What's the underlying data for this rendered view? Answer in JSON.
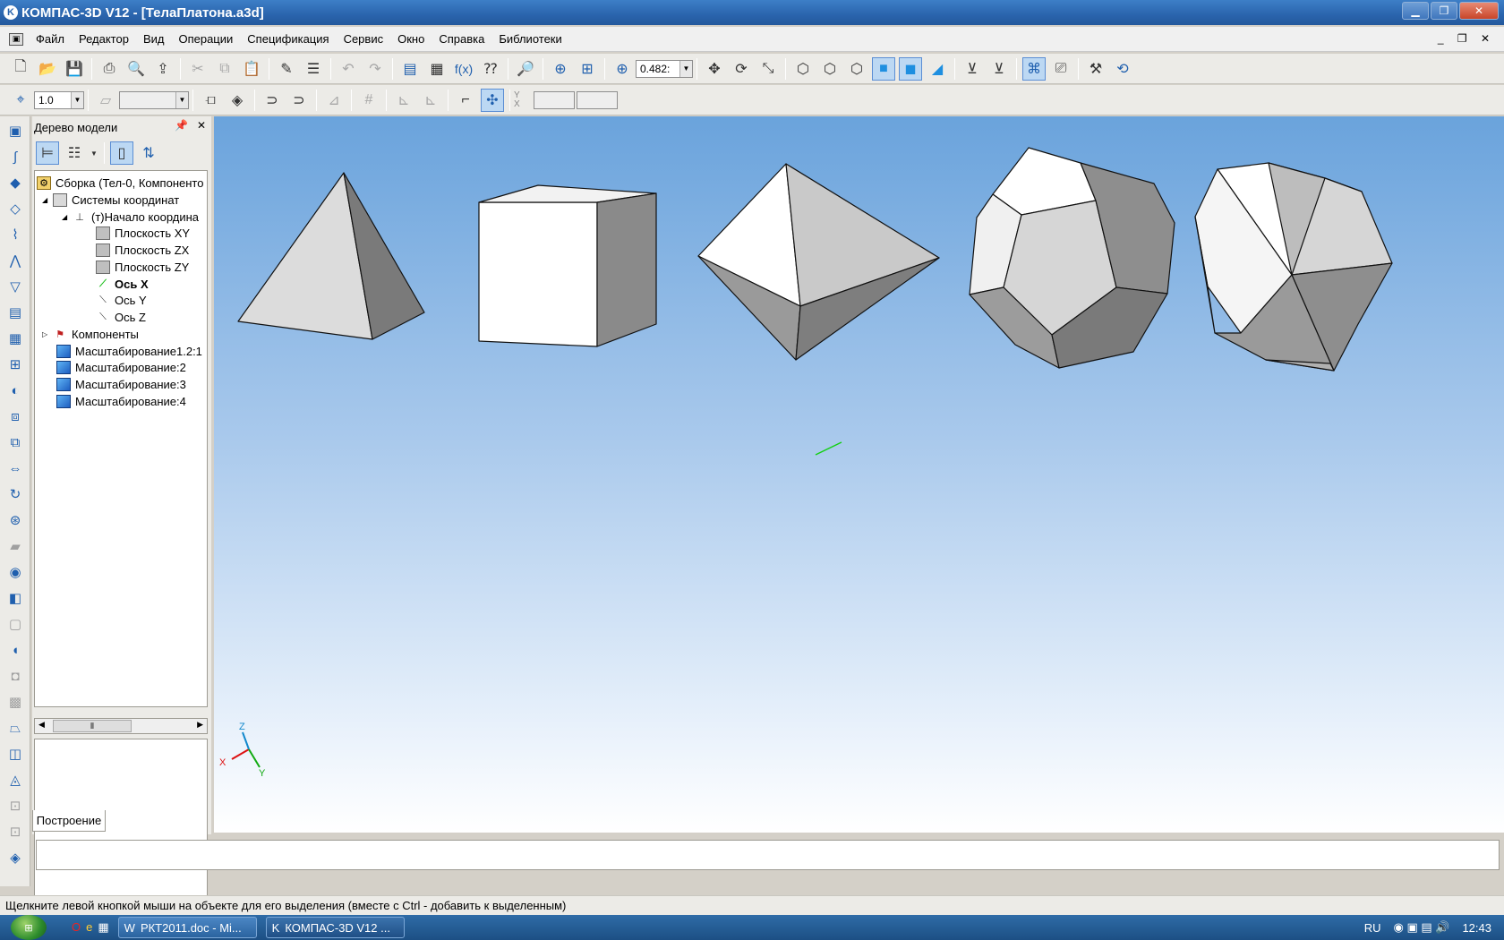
{
  "window": {
    "title": "КОМПАС-3D V12 - [ТелаПлатона.a3d]",
    "app_icon": "K"
  },
  "menu": [
    "Файл",
    "Редактор",
    "Вид",
    "Операции",
    "Спецификация",
    "Сервис",
    "Окно",
    "Справка",
    "Библиотеки"
  ],
  "toolbar": {
    "zoom_value": "0.482:"
  },
  "toolbar2": {
    "step_value": "1.0",
    "y_label": "Y",
    "x_label": "X"
  },
  "panel": {
    "title": "Дерево модели",
    "tab_label": "Построение",
    "tree": {
      "root": "Сборка (Тел-0, Компоненто",
      "coord_systems": "Системы координат",
      "origin": "(т)Начало координа",
      "plane_xy": "Плоскость XY",
      "plane_zx": "Плоскость ZX",
      "plane_zy": "Плоскость ZY",
      "axis_x": "Ось X",
      "axis_y": "Ось Y",
      "axis_z": "Ось Z",
      "components": "Компоненты",
      "scale1": "Масштабирование1.2:1",
      "scale2": "Масштабирование:2",
      "scale3": "Масштабирование:3",
      "scale4": "Масштабирование:4"
    }
  },
  "viewport": {
    "axis_x": "X",
    "axis_y": "Y",
    "axis_z": "Z"
  },
  "status": {
    "message": "Щелкните левой кнопкой мыши на объекте для его выделения (вместе с Ctrl - добавить к выделенным)"
  },
  "taskbar": {
    "task1": "РКТ2011.doc - Mi...",
    "task2": "КОМПАС-3D V12 ...",
    "lang": "RU",
    "time": "12:43"
  }
}
